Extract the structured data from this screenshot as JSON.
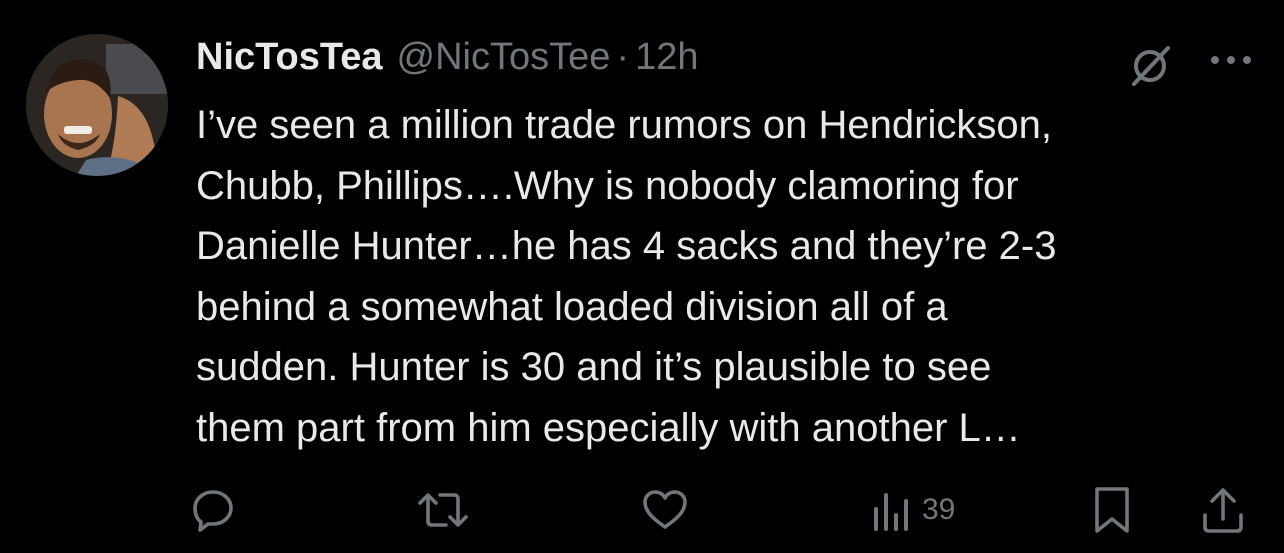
{
  "tweet": {
    "display_name": "NicTosTea",
    "handle": "@NicTosTee",
    "separator": "·",
    "time": "12h",
    "text": "I’ve seen a million trade rumors on Hendrickson,\nChubb, Phillips….Why is nobody clamoring for\nDanielle Hunter…he has 4 sacks and they’re 2-3\nbehind a somewhat loaded division all of a\nsudden. Hunter is 30 and it’s plausible to see\nthem part from him especially with another L…"
  },
  "actions": {
    "reply_icon": "reply-icon",
    "retweet_icon": "retweet-icon",
    "like_icon": "heart-icon",
    "views_icon": "analytics-icon",
    "views_count": "39",
    "bookmark_icon": "bookmark-icon",
    "share_icon": "share-icon"
  },
  "colors": {
    "background": "#000000",
    "text_primary": "#e7e9ea",
    "text_secondary": "#71767b"
  }
}
